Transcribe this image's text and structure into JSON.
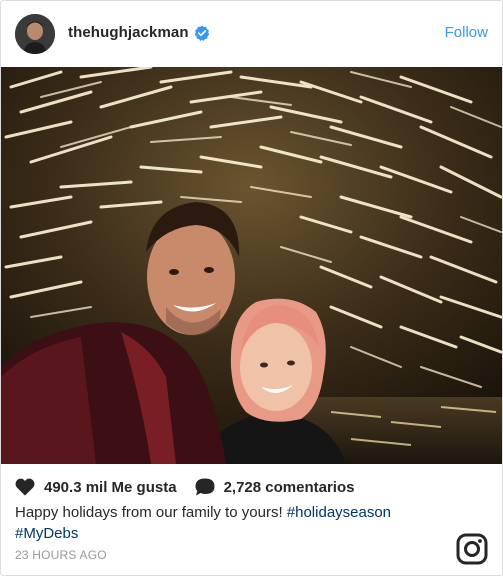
{
  "header": {
    "username": "thehughjackman",
    "follow_label": "Follow",
    "verified_icon": "verified-badge-icon"
  },
  "photo": {
    "alt_subject": "photo"
  },
  "stats": {
    "likes": "490.3 mil Me gusta",
    "comments": "2,728 comentarios"
  },
  "caption": {
    "text": "Happy holidays from our family to yours! ",
    "hashtag1": "#holidayseason",
    "hashtag2": "#MyDebs"
  },
  "timestamp": "23 HOURS AGO",
  "colors": {
    "accent": "#3897f0",
    "hashtag": "#003569",
    "muted": "#999999"
  }
}
